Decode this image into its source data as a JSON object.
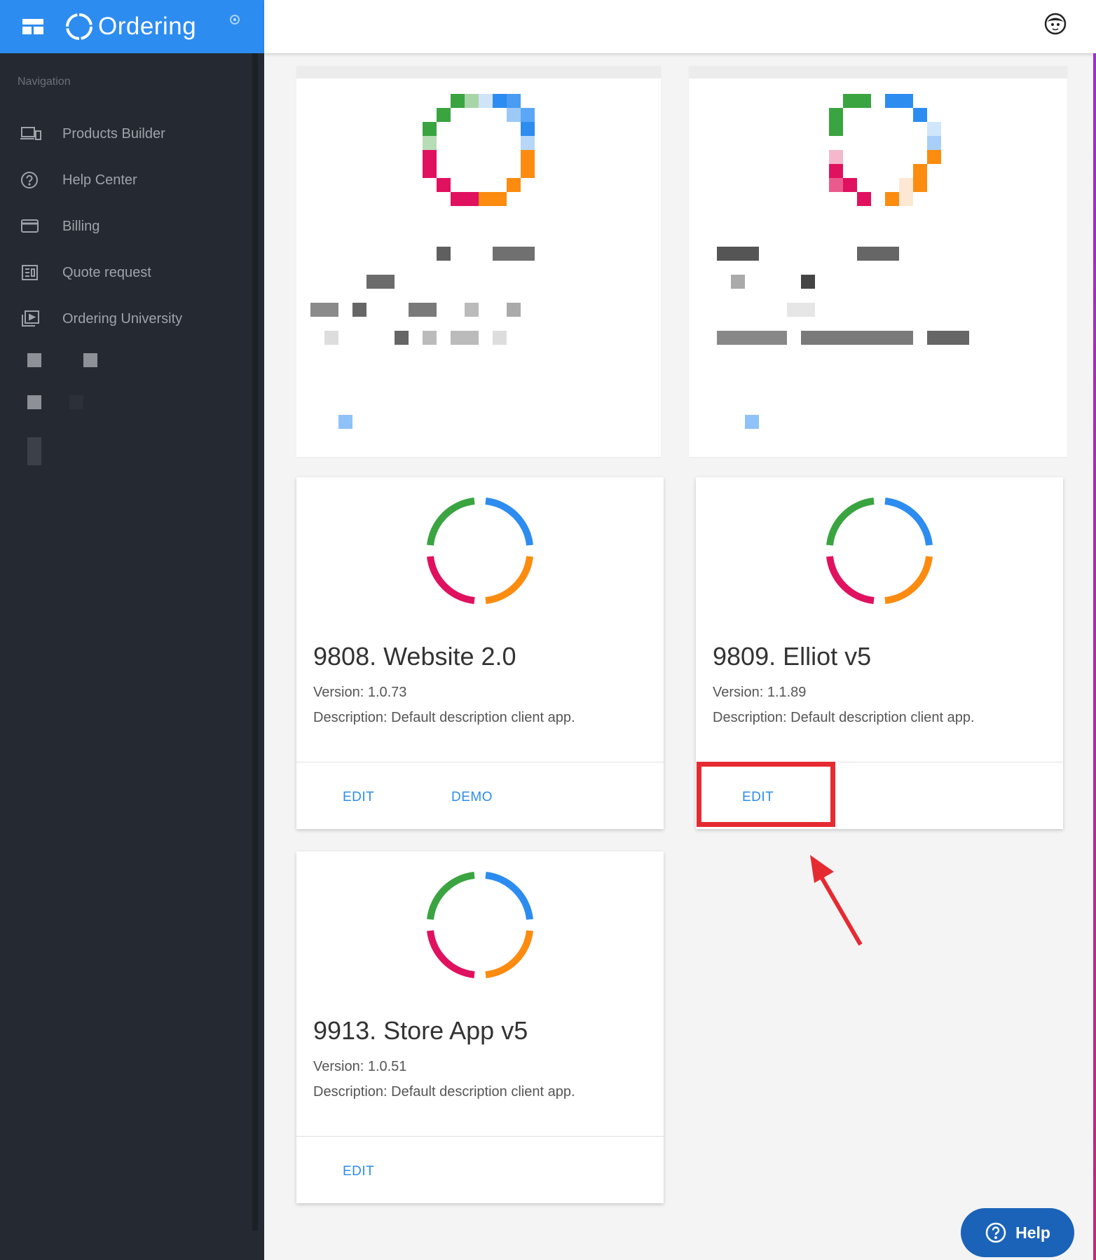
{
  "app": {
    "name": "Ordering"
  },
  "sidebar": {
    "heading": "Navigation",
    "items": [
      {
        "label": "Products Builder",
        "icon": "devices-icon"
      },
      {
        "label": "Help Center",
        "icon": "help-circle-icon"
      },
      {
        "label": "Billing",
        "icon": "credit-card-icon"
      },
      {
        "label": "Quote request",
        "icon": "receipt-icon"
      },
      {
        "label": "Ordering University",
        "icon": "video-library-icon"
      }
    ]
  },
  "apps": [
    {
      "title": "9808. Website 2.0",
      "version": "Version: 1.0.73",
      "description": "Description: Default description client app.",
      "actions": [
        "EDIT",
        "DEMO"
      ]
    },
    {
      "title": "9809. Elliot v5",
      "version": "Version: 1.1.89",
      "description": "Description: Default description client app.",
      "actions": [
        "EDIT"
      ]
    },
    {
      "title": "9913. Store App v5",
      "version": "Version: 1.0.51",
      "description": "Description: Default description client app.",
      "actions": [
        "EDIT"
      ]
    }
  ],
  "help_button": {
    "label": "Help"
  },
  "colors": {
    "brand_blue": "#2d8cf0",
    "sidebar_bg": "#252a32",
    "logo_green": "#3aa440",
    "logo_blue": "#2d8cf0",
    "logo_red": "#e0115f",
    "logo_orange": "#fb8c10",
    "annotation_red": "#e62a32"
  }
}
